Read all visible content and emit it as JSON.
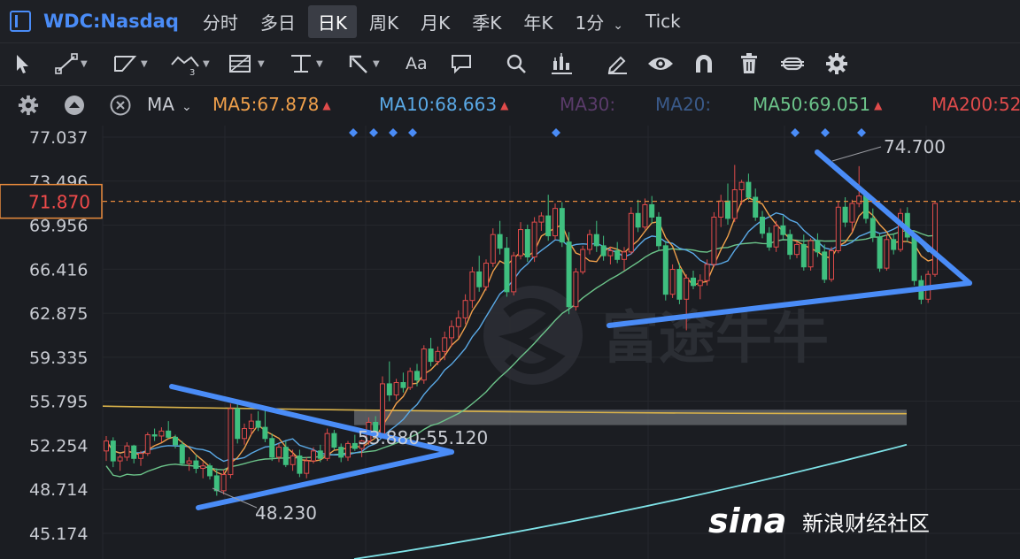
{
  "header": {
    "symbol": "WDC:Nasdaq",
    "tabs": [
      {
        "label": "分时",
        "active": false
      },
      {
        "label": "多日",
        "active": false
      },
      {
        "label": "日K",
        "active": true
      },
      {
        "label": "周K",
        "active": false
      },
      {
        "label": "月K",
        "active": false
      },
      {
        "label": "季K",
        "active": false
      },
      {
        "label": "年K",
        "active": false
      },
      {
        "label": "1分",
        "active": false,
        "dropdown": true
      },
      {
        "label": "Tick",
        "active": false
      }
    ]
  },
  "toolbar": {
    "tools": [
      "cursor-icon",
      "line-tool-icon",
      "polyline-tool-icon",
      "wave-tool-icon",
      "fib-tool-icon",
      "horizontal-line-icon",
      "arrow-tool-icon",
      "text-tool-icon",
      "comment-icon",
      "search-icon",
      "replay-icon",
      "draw-icon",
      "eye-icon",
      "magnet-icon",
      "trash-icon",
      "sync-icon",
      "settings-icon"
    ],
    "text_tool_label": "Aa"
  },
  "indicators": {
    "type_label": "MA",
    "items": [
      {
        "label": "MA5:67.878",
        "color": "#f0a04b",
        "arrow": "▲"
      },
      {
        "label": "MA10:68.663",
        "color": "#5aa9e6",
        "arrow": "▲"
      },
      {
        "label": "MA30:",
        "color": "#5a3b6a",
        "arrow": ""
      },
      {
        "label": "MA20:",
        "color": "#3a5a8a",
        "arrow": ""
      },
      {
        "label": "MA50:69.051",
        "color": "#6cc48a",
        "arrow": "▲"
      },
      {
        "label": "MA200:52",
        "color": "#e04b4b",
        "arrow": ""
      }
    ]
  },
  "chart_data": {
    "type": "candlestick",
    "symbol": "WDC:Nasdaq",
    "y_ticks": [
      "77.037",
      "73.496",
      "69.956",
      "66.416",
      "62.875",
      "59.335",
      "55.795",
      "52.254",
      "48.714",
      "45.174"
    ],
    "ylim": [
      42.5,
      78.5
    ],
    "current_price": "71.870",
    "annotations": {
      "high_label": "74.700",
      "low_label": "48.230",
      "zone_label": "53.880-55.120"
    },
    "colors": {
      "up": "#e04b4b",
      "down": "#3fbf7f"
    },
    "candles": [
      [
        51.8,
        53.0,
        51.0,
        52.6
      ],
      [
        52.6,
        52.9,
        50.5,
        51.0
      ],
      [
        51.0,
        51.5,
        50.2,
        51.3
      ],
      [
        51.3,
        52.5,
        51.0,
        52.2
      ],
      [
        52.2,
        52.3,
        50.8,
        51.2
      ],
      [
        51.2,
        51.8,
        50.6,
        51.6
      ],
      [
        51.6,
        53.3,
        51.4,
        53.1
      ],
      [
        53.1,
        53.6,
        52.6,
        53.0
      ],
      [
        53.0,
        53.7,
        52.5,
        53.4
      ],
      [
        53.4,
        54.2,
        52.8,
        52.9
      ],
      [
        52.9,
        53.1,
        52.0,
        52.3
      ],
      [
        52.3,
        52.6,
        50.6,
        50.8
      ],
      [
        50.8,
        51.3,
        50.2,
        51.0
      ],
      [
        51.0,
        51.5,
        50.0,
        50.4
      ],
      [
        50.4,
        50.9,
        49.6,
        50.6
      ],
      [
        50.6,
        50.8,
        49.5,
        49.8
      ],
      [
        49.8,
        50.4,
        48.2,
        48.6
      ],
      [
        48.6,
        50.3,
        48.3,
        49.9
      ],
      [
        49.9,
        55.6,
        49.6,
        55.2
      ],
      [
        55.2,
        55.7,
        52.4,
        52.8
      ],
      [
        52.8,
        54.0,
        52.3,
        53.6
      ],
      [
        53.6,
        54.8,
        53.1,
        54.2
      ],
      [
        54.2,
        55.0,
        53.4,
        53.7
      ],
      [
        53.7,
        55.3,
        52.5,
        52.8
      ],
      [
        52.8,
        53.2,
        51.0,
        51.3
      ],
      [
        51.3,
        52.4,
        50.9,
        52.1
      ],
      [
        52.1,
        52.6,
        50.5,
        50.7
      ],
      [
        50.7,
        51.9,
        50.2,
        51.4
      ],
      [
        51.4,
        51.9,
        49.7,
        50.0
      ],
      [
        50.0,
        51.3,
        49.6,
        51.0
      ],
      [
        51.0,
        52.1,
        50.8,
        51.8
      ],
      [
        51.8,
        52.3,
        50.9,
        51.2
      ],
      [
        51.2,
        53.6,
        51.0,
        53.2
      ],
      [
        53.2,
        53.5,
        51.9,
        52.1
      ],
      [
        52.1,
        52.4,
        50.9,
        51.3
      ],
      [
        51.3,
        52.6,
        51.0,
        52.4
      ],
      [
        52.4,
        53.1,
        51.8,
        52.0
      ],
      [
        52.0,
        52.7,
        51.3,
        52.6
      ],
      [
        52.6,
        54.5,
        52.3,
        54.1
      ],
      [
        54.1,
        54.6,
        52.9,
        53.2
      ],
      [
        53.2,
        57.8,
        53.0,
        57.2
      ],
      [
        57.2,
        59.0,
        55.8,
        56.3
      ],
      [
        56.3,
        57.6,
        55.9,
        57.3
      ],
      [
        57.3,
        58.1,
        56.5,
        56.9
      ],
      [
        56.9,
        58.5,
        56.7,
        58.2
      ],
      [
        58.2,
        58.8,
        57.0,
        57.5
      ],
      [
        57.5,
        60.3,
        57.2,
        60.0
      ],
      [
        60.0,
        60.9,
        58.6,
        59.0
      ],
      [
        59.0,
        60.2,
        58.7,
        59.8
      ],
      [
        59.8,
        61.4,
        59.1,
        60.9
      ],
      [
        60.9,
        62.3,
        60.2,
        61.8
      ],
      [
        61.8,
        63.1,
        60.9,
        62.5
      ],
      [
        62.5,
        64.4,
        62.0,
        63.9
      ],
      [
        63.9,
        66.6,
        63.3,
        66.2
      ],
      [
        66.2,
        67.5,
        64.6,
        65.0
      ],
      [
        65.0,
        67.2,
        64.7,
        66.9
      ],
      [
        66.9,
        69.7,
        66.6,
        69.2
      ],
      [
        69.2,
        70.3,
        67.6,
        68.1
      ],
      [
        68.1,
        69.0,
        64.2,
        64.6
      ],
      [
        64.6,
        67.8,
        64.3,
        67.5
      ],
      [
        67.5,
        70.2,
        67.2,
        69.6
      ],
      [
        69.6,
        70.0,
        67.0,
        67.4
      ],
      [
        67.4,
        70.6,
        67.0,
        70.2
      ],
      [
        70.2,
        71.0,
        69.5,
        70.7
      ],
      [
        70.7,
        72.4,
        68.7,
        69.1
      ],
      [
        69.1,
        71.7,
        68.8,
        71.3
      ],
      [
        71.3,
        71.8,
        68.2,
        68.6
      ],
      [
        68.6,
        69.4,
        62.8,
        63.4
      ],
      [
        63.4,
        66.5,
        63.1,
        66.2
      ],
      [
        66.2,
        68.3,
        66.0,
        68.0
      ],
      [
        68.0,
        69.6,
        67.6,
        69.2
      ],
      [
        69.2,
        70.3,
        67.8,
        68.3
      ],
      [
        68.3,
        69.1,
        67.1,
        67.5
      ],
      [
        67.5,
        68.2,
        66.8,
        67.9
      ],
      [
        67.9,
        68.6,
        66.9,
        67.2
      ],
      [
        67.2,
        68.2,
        66.3,
        67.8
      ],
      [
        67.8,
        71.4,
        67.6,
        70.9
      ],
      [
        70.9,
        72.0,
        69.4,
        69.8
      ],
      [
        69.8,
        72.1,
        69.6,
        71.6
      ],
      [
        71.6,
        72.3,
        70.1,
        70.6
      ],
      [
        70.6,
        71.0,
        67.9,
        68.3
      ],
      [
        68.3,
        68.7,
        63.9,
        64.4
      ],
      [
        64.4,
        66.8,
        64.1,
        66.4
      ],
      [
        66.4,
        66.9,
        63.6,
        64.0
      ],
      [
        64.0,
        66.0,
        61.5,
        65.7
      ],
      [
        65.7,
        66.3,
        64.8,
        65.1
      ],
      [
        65.1,
        66.0,
        64.0,
        65.5
      ],
      [
        65.5,
        67.2,
        65.1,
        66.8
      ],
      [
        66.8,
        71.0,
        66.6,
        70.6
      ],
      [
        70.6,
        72.4,
        69.8,
        71.9
      ],
      [
        71.9,
        73.3,
        70.0,
        70.5
      ],
      [
        70.5,
        74.8,
        70.2,
        72.8
      ],
      [
        72.8,
        73.6,
        71.6,
        73.4
      ],
      [
        73.4,
        74.1,
        72.0,
        72.2
      ],
      [
        72.2,
        72.9,
        70.3,
        70.6
      ],
      [
        70.6,
        71.1,
        68.9,
        69.3
      ],
      [
        69.3,
        69.8,
        67.9,
        68.2
      ],
      [
        68.2,
        70.3,
        67.8,
        69.9
      ],
      [
        69.9,
        70.7,
        68.8,
        69.2
      ],
      [
        69.2,
        69.6,
        67.2,
        67.6
      ],
      [
        67.6,
        68.7,
        67.3,
        68.4
      ],
      [
        68.4,
        69.2,
        66.3,
        66.6
      ],
      [
        66.6,
        68.9,
        66.3,
        68.7
      ],
      [
        68.7,
        69.3,
        67.4,
        67.8
      ],
      [
        67.8,
        68.4,
        65.3,
        65.6
      ],
      [
        65.6,
        68.2,
        65.4,
        67.9
      ],
      [
        67.9,
        71.9,
        67.7,
        71.4
      ],
      [
        71.4,
        72.2,
        69.8,
        70.2
      ],
      [
        70.2,
        72.0,
        69.4,
        71.7
      ],
      [
        71.7,
        74.7,
        71.4,
        72.3
      ],
      [
        72.3,
        72.6,
        70.1,
        70.5
      ],
      [
        70.5,
        71.3,
        68.6,
        69.0
      ],
      [
        69.0,
        69.3,
        66.2,
        66.5
      ],
      [
        66.5,
        69.2,
        66.3,
        68.8
      ],
      [
        68.8,
        69.3,
        67.6,
        68.0
      ],
      [
        68.0,
        71.3,
        67.8,
        70.9
      ],
      [
        70.9,
        71.4,
        68.6,
        69.0
      ],
      [
        69.0,
        69.3,
        65.1,
        65.5
      ],
      [
        65.5,
        65.9,
        63.6,
        64.0
      ],
      [
        64.0,
        66.3,
        63.7,
        66.0
      ],
      [
        66.0,
        71.9,
        65.8,
        71.7
      ]
    ]
  },
  "watermarks": {
    "futu_text": "富途牛牛",
    "sina_logo": "sina",
    "sina_text": "新浪财经社区"
  }
}
